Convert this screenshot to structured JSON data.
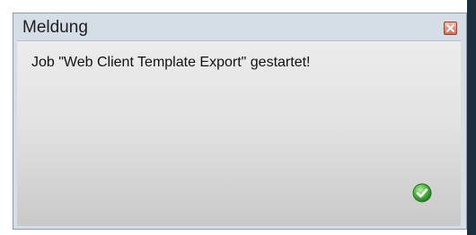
{
  "dialog": {
    "title": "Meldung",
    "message": "Job \"Web Client Template Export\" gestartet!",
    "close_icon": "close-icon",
    "status_icon": "success-check-icon"
  },
  "colors": {
    "frame": "#d5dde6",
    "body_top": "#ececec",
    "body_bottom": "#c9c9c9",
    "close_button": "#d86a52",
    "success": "#3fa83a"
  }
}
